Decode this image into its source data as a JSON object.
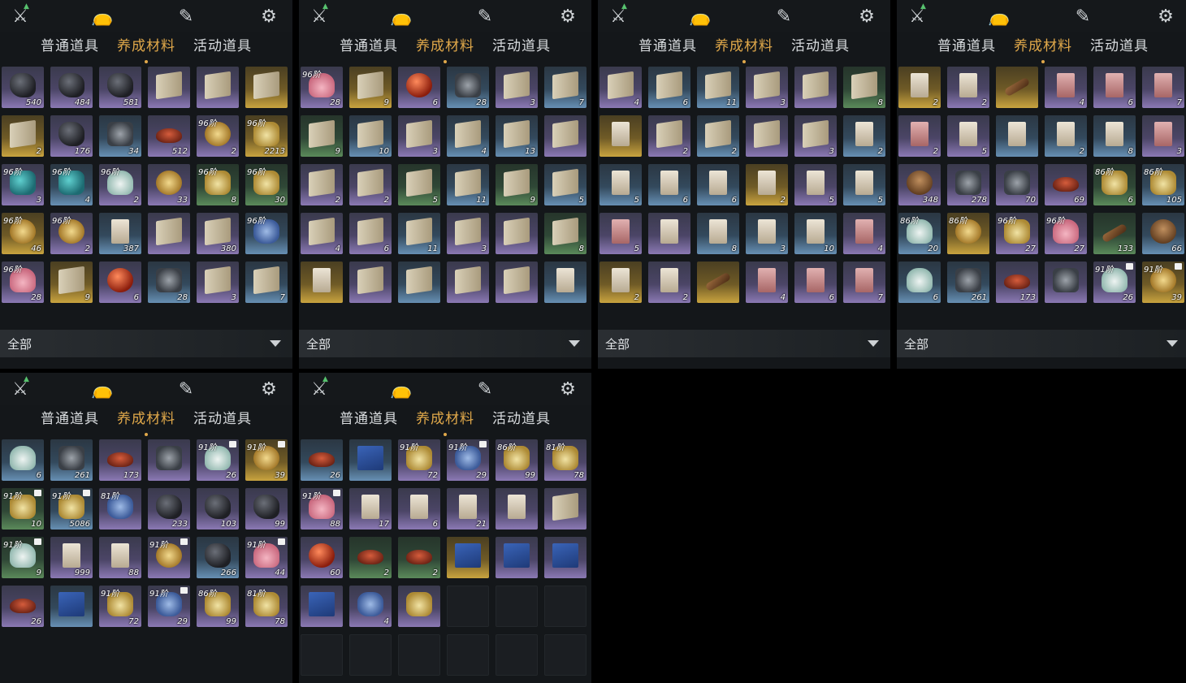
{
  "tabs": [
    "普通道具",
    "养成材料",
    "活动道具"
  ],
  "active_tab": "养成材料",
  "filter_label": "全部",
  "icons": [
    "crossed-swords-icon",
    "money-bag-icon",
    "scroll-brush-icon",
    "gear-token-icon"
  ],
  "panels": [
    {
      "name": "panel-1",
      "rows": [
        [
          {
            "c": "purple",
            "i": "stone",
            "n": "540"
          },
          {
            "c": "purple",
            "i": "stone",
            "n": "484"
          },
          {
            "c": "purple",
            "i": "stone",
            "n": "581"
          },
          {
            "c": "purple",
            "i": "book",
            "n": ""
          },
          {
            "c": "purple",
            "i": "book",
            "n": ""
          },
          {
            "c": "gold",
            "i": "book",
            "n": ""
          }
        ],
        [
          {
            "c": "gold",
            "i": "book",
            "n": "2"
          },
          {
            "c": "purple",
            "i": "stone",
            "n": "176"
          },
          {
            "c": "blue",
            "i": "metal",
            "n": "34"
          },
          {
            "c": "purple",
            "i": "bowl",
            "n": "512"
          },
          {
            "c": "purple",
            "i": "shell",
            "n": "2",
            "t": "96阶"
          },
          {
            "c": "gold",
            "i": "herb",
            "n": "2213",
            "t": "96阶"
          }
        ],
        [
          {
            "c": "purple",
            "i": "gem",
            "n": "3",
            "t": "96阶"
          },
          {
            "c": "blue",
            "i": "gem",
            "n": "4",
            "t": "96阶"
          },
          {
            "c": "purple",
            "i": "white",
            "n": "2",
            "t": "96阶"
          },
          {
            "c": "purple",
            "i": "shell",
            "n": "33"
          },
          {
            "c": "green",
            "i": "herb",
            "n": "8",
            "t": "96阶"
          },
          {
            "c": "green",
            "i": "herb",
            "n": "30",
            "t": "96阶"
          }
        ],
        [
          {
            "c": "gold",
            "i": "shell",
            "n": "46",
            "t": "96阶"
          },
          {
            "c": "purple",
            "i": "shell",
            "n": "2",
            "t": "96阶"
          },
          {
            "c": "blue",
            "i": "scroll",
            "n": "387"
          },
          {
            "c": "purple",
            "i": "book",
            "n": ""
          },
          {
            "c": "purple",
            "i": "book",
            "n": "380"
          },
          {
            "c": "blue",
            "i": "lotus",
            "n": "",
            "t": "96阶"
          }
        ],
        [
          {
            "c": "purple",
            "i": "flower",
            "n": "28",
            "t": "96阶"
          },
          {
            "c": "gold",
            "i": "book",
            "n": "9"
          },
          {
            "c": "purple",
            "i": "orb",
            "n": "6"
          },
          {
            "c": "blue",
            "i": "metal",
            "n": "28"
          },
          {
            "c": "purple",
            "i": "book",
            "n": "3"
          },
          {
            "c": "blue",
            "i": "book",
            "n": "7"
          }
        ]
      ]
    },
    {
      "name": "panel-2",
      "rows": [
        [
          {
            "c": "purple",
            "i": "flower",
            "n": "28",
            "t": "96阶"
          },
          {
            "c": "gold",
            "i": "book",
            "n": "9"
          },
          {
            "c": "purple",
            "i": "orb",
            "n": "6"
          },
          {
            "c": "blue",
            "i": "metal",
            "n": "28"
          },
          {
            "c": "purple",
            "i": "book",
            "n": "3"
          },
          {
            "c": "blue",
            "i": "book",
            "n": "7"
          }
        ],
        [
          {
            "c": "green",
            "i": "book",
            "n": "9"
          },
          {
            "c": "blue",
            "i": "book",
            "n": "10"
          },
          {
            "c": "purple",
            "i": "book",
            "n": "3"
          },
          {
            "c": "blue",
            "i": "book",
            "n": "4"
          },
          {
            "c": "blue",
            "i": "book",
            "n": "13"
          },
          {
            "c": "purple",
            "i": "book",
            "n": ""
          }
        ],
        [
          {
            "c": "purple",
            "i": "book",
            "n": "2"
          },
          {
            "c": "purple",
            "i": "book",
            "n": "2"
          },
          {
            "c": "green",
            "i": "book",
            "n": "5"
          },
          {
            "c": "blue",
            "i": "book",
            "n": "11"
          },
          {
            "c": "green",
            "i": "book",
            "n": "9"
          },
          {
            "c": "blue",
            "i": "book",
            "n": "5"
          }
        ],
        [
          {
            "c": "purple",
            "i": "book",
            "n": "4"
          },
          {
            "c": "purple",
            "i": "book",
            "n": "6"
          },
          {
            "c": "blue",
            "i": "book",
            "n": "11"
          },
          {
            "c": "purple",
            "i": "book",
            "n": "3"
          },
          {
            "c": "purple",
            "i": "book",
            "n": ""
          },
          {
            "c": "green",
            "i": "book",
            "n": "8"
          }
        ],
        [
          {
            "c": "gold",
            "i": "scroll",
            "n": ""
          },
          {
            "c": "purple",
            "i": "book",
            "n": ""
          },
          {
            "c": "blue",
            "i": "book",
            "n": ""
          },
          {
            "c": "purple",
            "i": "book",
            "n": ""
          },
          {
            "c": "purple",
            "i": "book",
            "n": ""
          },
          {
            "c": "blue",
            "i": "scroll",
            "n": ""
          }
        ]
      ]
    },
    {
      "name": "panel-3",
      "rows": [
        [
          {
            "c": "purple",
            "i": "book",
            "n": "4"
          },
          {
            "c": "blue",
            "i": "book",
            "n": "6"
          },
          {
            "c": "blue",
            "i": "book",
            "n": "11"
          },
          {
            "c": "purple",
            "i": "book",
            "n": "3"
          },
          {
            "c": "purple",
            "i": "book",
            "n": ""
          },
          {
            "c": "green",
            "i": "book",
            "n": "8"
          }
        ],
        [
          {
            "c": "gold",
            "i": "scroll",
            "n": ""
          },
          {
            "c": "purple",
            "i": "book",
            "n": "2"
          },
          {
            "c": "blue",
            "i": "book",
            "n": "2"
          },
          {
            "c": "purple",
            "i": "book",
            "n": ""
          },
          {
            "c": "purple",
            "i": "book",
            "n": "3"
          },
          {
            "c": "blue",
            "i": "scroll",
            "n": "2"
          }
        ],
        [
          {
            "c": "blue",
            "i": "scroll",
            "n": "5"
          },
          {
            "c": "blue",
            "i": "scroll",
            "n": "6"
          },
          {
            "c": "blue",
            "i": "scroll",
            "n": "6"
          },
          {
            "c": "gold",
            "i": "scroll",
            "n": "2"
          },
          {
            "c": "purple",
            "i": "scroll",
            "n": "5"
          },
          {
            "c": "blue",
            "i": "scroll",
            "n": "5"
          }
        ],
        [
          {
            "c": "purple",
            "i": "redscroll",
            "n": "5"
          },
          {
            "c": "purple",
            "i": "scroll",
            "n": ""
          },
          {
            "c": "blue",
            "i": "scroll",
            "n": "8"
          },
          {
            "c": "blue",
            "i": "scroll",
            "n": "3"
          },
          {
            "c": "blue",
            "i": "scroll",
            "n": "10"
          },
          {
            "c": "purple",
            "i": "redscroll",
            "n": "4"
          }
        ],
        [
          {
            "c": "gold",
            "i": "scroll",
            "n": "2"
          },
          {
            "c": "purple",
            "i": "scroll",
            "n": "2"
          },
          {
            "c": "gold",
            "i": "wood",
            "n": ""
          },
          {
            "c": "purple",
            "i": "redscroll",
            "n": "4"
          },
          {
            "c": "purple",
            "i": "redscroll",
            "n": "6"
          },
          {
            "c": "purple",
            "i": "redscroll",
            "n": "7"
          }
        ]
      ]
    },
    {
      "name": "panel-4",
      "rows": [
        [
          {
            "c": "gold",
            "i": "scroll",
            "n": "2"
          },
          {
            "c": "purple",
            "i": "scroll",
            "n": "2"
          },
          {
            "c": "gold",
            "i": "wood",
            "n": ""
          },
          {
            "c": "purple",
            "i": "redscroll",
            "n": "4"
          },
          {
            "c": "purple",
            "i": "redscroll",
            "n": "6"
          },
          {
            "c": "purple",
            "i": "redscroll",
            "n": "7"
          }
        ],
        [
          {
            "c": "purple",
            "i": "redscroll",
            "n": "2"
          },
          {
            "c": "purple",
            "i": "scroll",
            "n": "5"
          },
          {
            "c": "blue",
            "i": "scroll",
            "n": ""
          },
          {
            "c": "blue",
            "i": "scroll",
            "n": "2"
          },
          {
            "c": "blue",
            "i": "scroll",
            "n": "8"
          },
          {
            "c": "purple",
            "i": "redscroll",
            "n": "3"
          }
        ],
        [
          {
            "c": "purple",
            "i": "pot",
            "n": "348"
          },
          {
            "c": "purple",
            "i": "metal",
            "n": "278"
          },
          {
            "c": "purple",
            "i": "metal",
            "n": "70"
          },
          {
            "c": "purple",
            "i": "bowl",
            "n": "69"
          },
          {
            "c": "green",
            "i": "herb",
            "n": "6",
            "t": "86阶"
          },
          {
            "c": "blue",
            "i": "herb",
            "n": "105",
            "t": "86阶"
          }
        ],
        [
          {
            "c": "blue",
            "i": "white",
            "n": "20",
            "t": "86阶"
          },
          {
            "c": "gold",
            "i": "shell",
            "n": "",
            "t": "86阶"
          },
          {
            "c": "purple",
            "i": "herb",
            "n": "27",
            "t": "96阶"
          },
          {
            "c": "purple",
            "i": "flower",
            "n": "27",
            "t": "96阶"
          },
          {
            "c": "green",
            "i": "wood",
            "n": "133"
          },
          {
            "c": "blue",
            "i": "pot",
            "n": "66"
          }
        ],
        [
          {
            "c": "blue",
            "i": "white",
            "n": "6"
          },
          {
            "c": "blue",
            "i": "metal",
            "n": "261"
          },
          {
            "c": "purple",
            "i": "bowl",
            "n": "173"
          },
          {
            "c": "purple",
            "i": "metal",
            "n": ""
          },
          {
            "c": "purple",
            "i": "white",
            "n": "26",
            "t": "91阶",
            "b": true
          },
          {
            "c": "gold",
            "i": "shell",
            "n": "39",
            "t": "91阶",
            "b": true
          }
        ]
      ]
    },
    {
      "name": "panel-5",
      "rows": [
        [
          {
            "c": "blue",
            "i": "white",
            "n": "6"
          },
          {
            "c": "blue",
            "i": "metal",
            "n": "261"
          },
          {
            "c": "purple",
            "i": "bowl",
            "n": "173"
          },
          {
            "c": "purple",
            "i": "metal",
            "n": ""
          },
          {
            "c": "purple",
            "i": "white",
            "n": "26",
            "t": "91阶",
            "b": true
          },
          {
            "c": "gold",
            "i": "shell",
            "n": "39",
            "t": "91阶",
            "b": true
          }
        ],
        [
          {
            "c": "green",
            "i": "herb",
            "n": "10",
            "t": "91阶",
            "b": true
          },
          {
            "c": "blue",
            "i": "herb",
            "n": "5086",
            "t": "91阶",
            "b": true
          },
          {
            "c": "purple",
            "i": "lotus",
            "n": "",
            "t": "81阶"
          },
          {
            "c": "purple",
            "i": "stone",
            "n": "233"
          },
          {
            "c": "purple",
            "i": "stone",
            "n": "103"
          },
          {
            "c": "purple",
            "i": "stone",
            "n": "99"
          }
        ],
        [
          {
            "c": "green",
            "i": "white",
            "n": "9",
            "t": "91阶",
            "b": true
          },
          {
            "c": "purple",
            "i": "scroll",
            "n": "999"
          },
          {
            "c": "purple",
            "i": "scroll",
            "n": "88"
          },
          {
            "c": "purple",
            "i": "shell",
            "n": "",
            "t": "91阶",
            "b": true
          },
          {
            "c": "blue",
            "i": "stone",
            "n": "266"
          },
          {
            "c": "purple",
            "i": "flower",
            "n": "44",
            "t": "91阶",
            "b": true
          }
        ],
        [
          {
            "c": "purple",
            "i": "bowl",
            "n": "26"
          },
          {
            "c": "blue",
            "i": "bluebook",
            "n": ""
          },
          {
            "c": "purple",
            "i": "herb",
            "n": "72",
            "t": "91阶"
          },
          {
            "c": "purple",
            "i": "lotus",
            "n": "29",
            "t": "91阶",
            "b": true
          },
          {
            "c": "purple",
            "i": "herb",
            "n": "99",
            "t": "86阶"
          },
          {
            "c": "purple",
            "i": "herb",
            "n": "78",
            "t": "81阶"
          }
        ]
      ]
    },
    {
      "name": "panel-6",
      "rows": [
        [
          {
            "c": "blue",
            "i": "bowl",
            "n": "26"
          },
          {
            "c": "blue",
            "i": "bluebook",
            "n": ""
          },
          {
            "c": "purple",
            "i": "herb",
            "n": "72",
            "t": "91阶"
          },
          {
            "c": "purple",
            "i": "lotus",
            "n": "29",
            "t": "91阶",
            "b": true
          },
          {
            "c": "purple",
            "i": "herb",
            "n": "99",
            "t": "86阶"
          },
          {
            "c": "purple",
            "i": "herb",
            "n": "78",
            "t": "81阶"
          }
        ],
        [
          {
            "c": "purple",
            "i": "flower",
            "n": "88",
            "t": "91阶",
            "b": true
          },
          {
            "c": "purple",
            "i": "scroll",
            "n": "17"
          },
          {
            "c": "purple",
            "i": "scroll",
            "n": "6"
          },
          {
            "c": "purple",
            "i": "scroll",
            "n": "21"
          },
          {
            "c": "purple",
            "i": "scroll",
            "n": ""
          },
          {
            "c": "purple",
            "i": "book",
            "n": ""
          }
        ],
        [
          {
            "c": "purple",
            "i": "orb",
            "n": "60"
          },
          {
            "c": "green",
            "i": "bowl",
            "n": "2"
          },
          {
            "c": "green",
            "i": "bowl",
            "n": "2"
          },
          {
            "c": "gold",
            "i": "bluebook",
            "n": ""
          },
          {
            "c": "purple",
            "i": "bluebook",
            "n": ""
          },
          {
            "c": "purple",
            "i": "bluebook",
            "n": ""
          }
        ],
        [
          {
            "c": "purple",
            "i": "bluebook",
            "n": ""
          },
          {
            "c": "purple",
            "i": "lotus",
            "n": "4"
          },
          {
            "c": "purple",
            "i": "herb",
            "n": ""
          },
          {
            "c": "empty"
          },
          {
            "c": "empty"
          },
          {
            "c": "empty"
          }
        ],
        [
          {
            "c": "empty"
          },
          {
            "c": "empty"
          },
          {
            "c": "empty"
          },
          {
            "c": "empty"
          },
          {
            "c": "empty"
          },
          {
            "c": "empty"
          }
        ]
      ]
    }
  ]
}
